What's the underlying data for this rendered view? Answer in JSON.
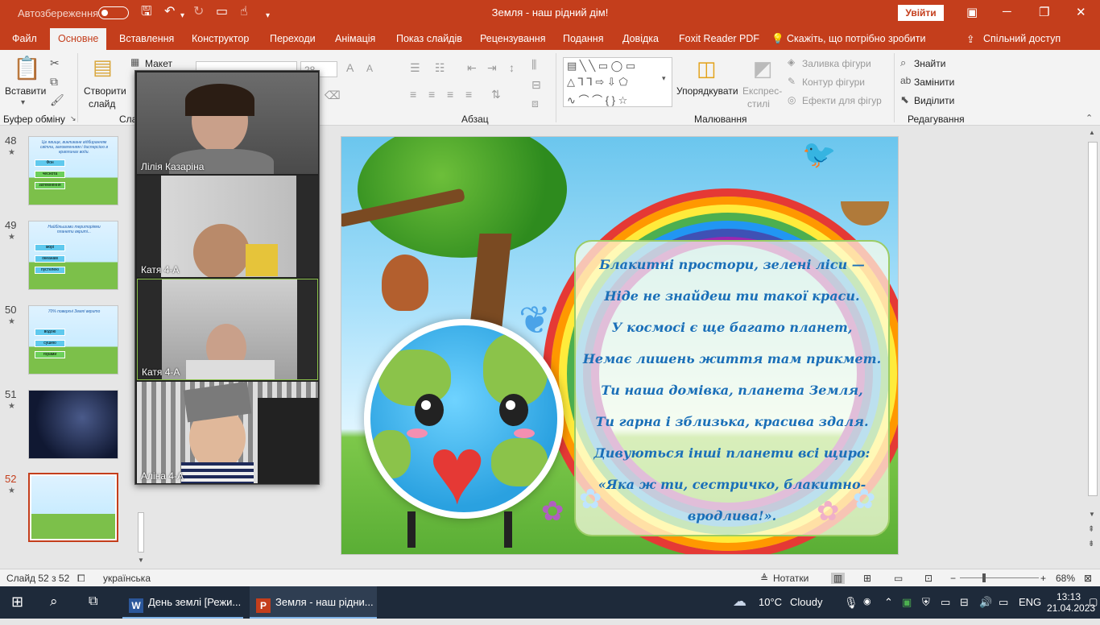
{
  "titlebar": {
    "autosave_label": "Автозбереження",
    "document_title": "Земля - наш рідний дім!",
    "sign_in": "Увійти"
  },
  "tabs": [
    "Файл",
    "Основне",
    "Вставлення",
    "Конструктор",
    "Переходи",
    "Анімація",
    "Показ слайдів",
    "Рецензування",
    "Подання",
    "Довідка",
    "Foxit Reader PDF"
  ],
  "tell_me": "Скажіть, що потрібно зробити",
  "share": "Спільний доступ",
  "ribbon": {
    "paste": "Вставити",
    "clipboard_group": "Буфер обміну",
    "new_slide_line1": "Створити",
    "new_slide_line2": "слайд",
    "layout": "Макет",
    "slides_group_partial": "Сла",
    "font_size": "28",
    "paragraph_group": "Абзац",
    "arrange": "Упорядкувати",
    "quick_styles_line1": "Експрес-",
    "quick_styles_line2": "стилі",
    "shape_fill": "Заливка фігури",
    "shape_outline": "Контур фігури",
    "shape_effects": "Ефекти для фігур",
    "drawing_group": "Малювання",
    "find": "Знайти",
    "replace": "Замінити",
    "select": "Виділити",
    "editing_group": "Редагування"
  },
  "thumbnails": [
    {
      "num": "48",
      "btns": [
        "Фон",
        "чеснота",
        "затемнення"
      ]
    },
    {
      "num": "49",
      "btns": [
        "морі",
        "океанам",
        "пустелею"
      ]
    },
    {
      "num": "50",
      "btns": [
        "водою",
        "сушею",
        "горами"
      ]
    },
    {
      "num": "51"
    },
    {
      "num": "52"
    }
  ],
  "thumb_texts": {
    "t48": "Це явище, викликане відбиранням світла, заломленням і дисперсією в краплинах води.",
    "t49": "Найбільшими територіями планети вкриті...",
    "t50": "70% поверхні Землі вкрито"
  },
  "video": {
    "participants": [
      "Лілія Казаріна",
      "Катя  4-А",
      "Катя 4-А",
      "Аліна 4-А"
    ]
  },
  "slide": {
    "poem": [
      "Блакитні простори, зелені ліси —",
      "Ніде не знайдеш ти такої краси.",
      "У космосі є ще багато планет,",
      "Немає лишень життя там прикмет.",
      "Ти наша домівка, планета Земля,",
      "Ти гарна і зблизька, красива здаля.",
      "Дивуються інші планети всі щиро:",
      "«Яка ж ти, сестричко, блакитно-",
      "вродлива!»."
    ]
  },
  "statusbar": {
    "slide_count": "Слайд 52 з 52",
    "language": "українська",
    "notes": "Нотатки",
    "zoom": "68%"
  },
  "taskbar": {
    "word_app": "День землі [Режи...",
    "ppt_app": "Земля - наш рідни...",
    "temperature": "10°C",
    "weather": "Cloudy",
    "lang": "ENG",
    "time": "13:13",
    "date": "21.04.2023"
  },
  "colors": {
    "accent": "#c43e1c",
    "poem_text": "#1a6fb8"
  }
}
